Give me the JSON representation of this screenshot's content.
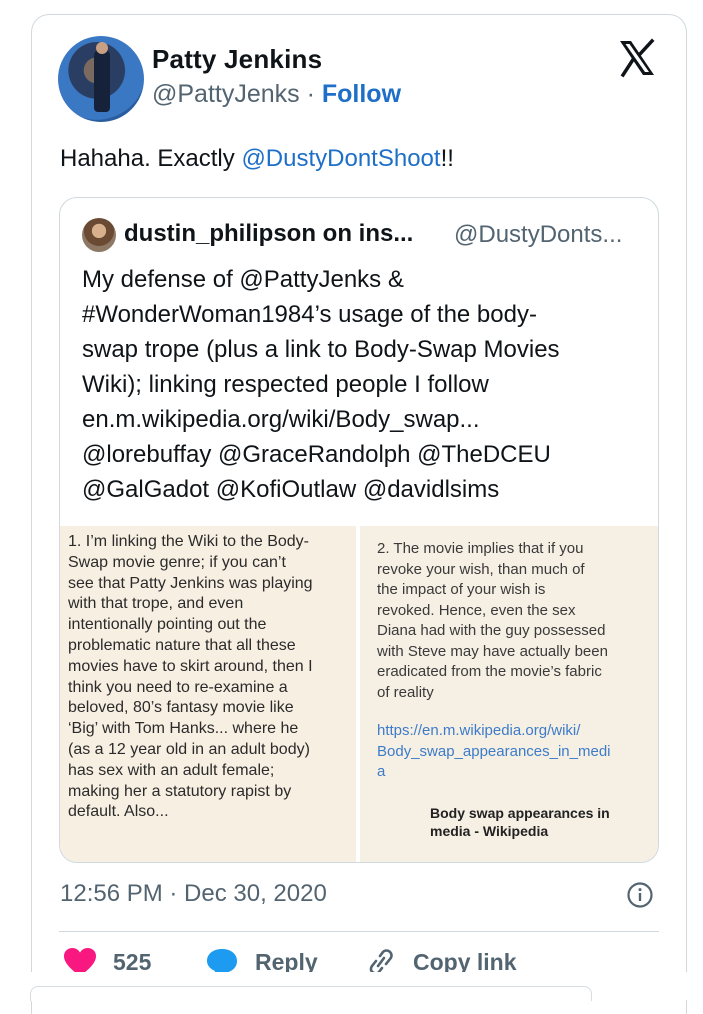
{
  "tweet": {
    "author_name": "Patty Jenkins",
    "author_handle": "@PattyJenks",
    "separator": " · ",
    "follow_label": "Follow",
    "text_prefix": "Hahaha. Exactly ",
    "text_mention": "@DustyDontShoot",
    "text_suffix": "!!",
    "timestamp": "12:56 PM · Dec 30, 2020"
  },
  "quote": {
    "author_name": "dustin_philipson on ins...",
    "author_handle": "@DustyDonts...",
    "text": "My defense of @PattyJenks &\n#WonderWoman1984’s usage of the body-\nswap trope (plus a link to Body-Swap Movies\nWiki); linking respected people I follow\nen.m.wikipedia.org/wiki/Body_swap...\n@lorebuffay @GraceRandolph @TheDCEU\n@GalGadot @KofiOutlaw @davidlsims",
    "media_left_text": "1. I’m linking the Wiki to the Body-\nSwap movie genre; if you can’t\nsee that Patty Jenkins was playing\nwith that trope, and even\nintentionally pointing out the\nproblematic nature that all these\nmovies have to skirt around, then I\nthink you need to re-examine a\nbeloved, 80’s fantasy movie like\n‘Big’ with Tom Hanks... where he\n(as a 12 year old in an adult body)\nhas sex with an adult female;\nmaking her a statutory rapist by\ndefault. Also...",
    "media_right_text": "2. The movie implies that if you\nrevoke your wish, than much of\nthe impact of your wish is\nrevoked. Hence, even the sex\nDiana had with the guy possessed\nwith Steve may have actually been\neradicated from the movie’s fabric\nof reality",
    "media_right_link": "https://en.m.wikipedia.org/wiki/\nBody_swap_appearances_in_medi\na",
    "media_right_card_title": "Body swap appearances in\nmedia - Wikipedia"
  },
  "actions": {
    "like_count": "525",
    "reply_label": "Reply",
    "copy_link_label": "Copy link"
  },
  "icons": {
    "logo": "x-logo-icon",
    "info": "info-icon",
    "like": "heart-icon",
    "reply": "reply-bubble-icon",
    "copy": "link-icon"
  },
  "colors": {
    "link": "#1d6fc8",
    "muted": "#536471",
    "like": "#f91880",
    "reply": "#1d9bf0",
    "border": "#cfd9de"
  }
}
